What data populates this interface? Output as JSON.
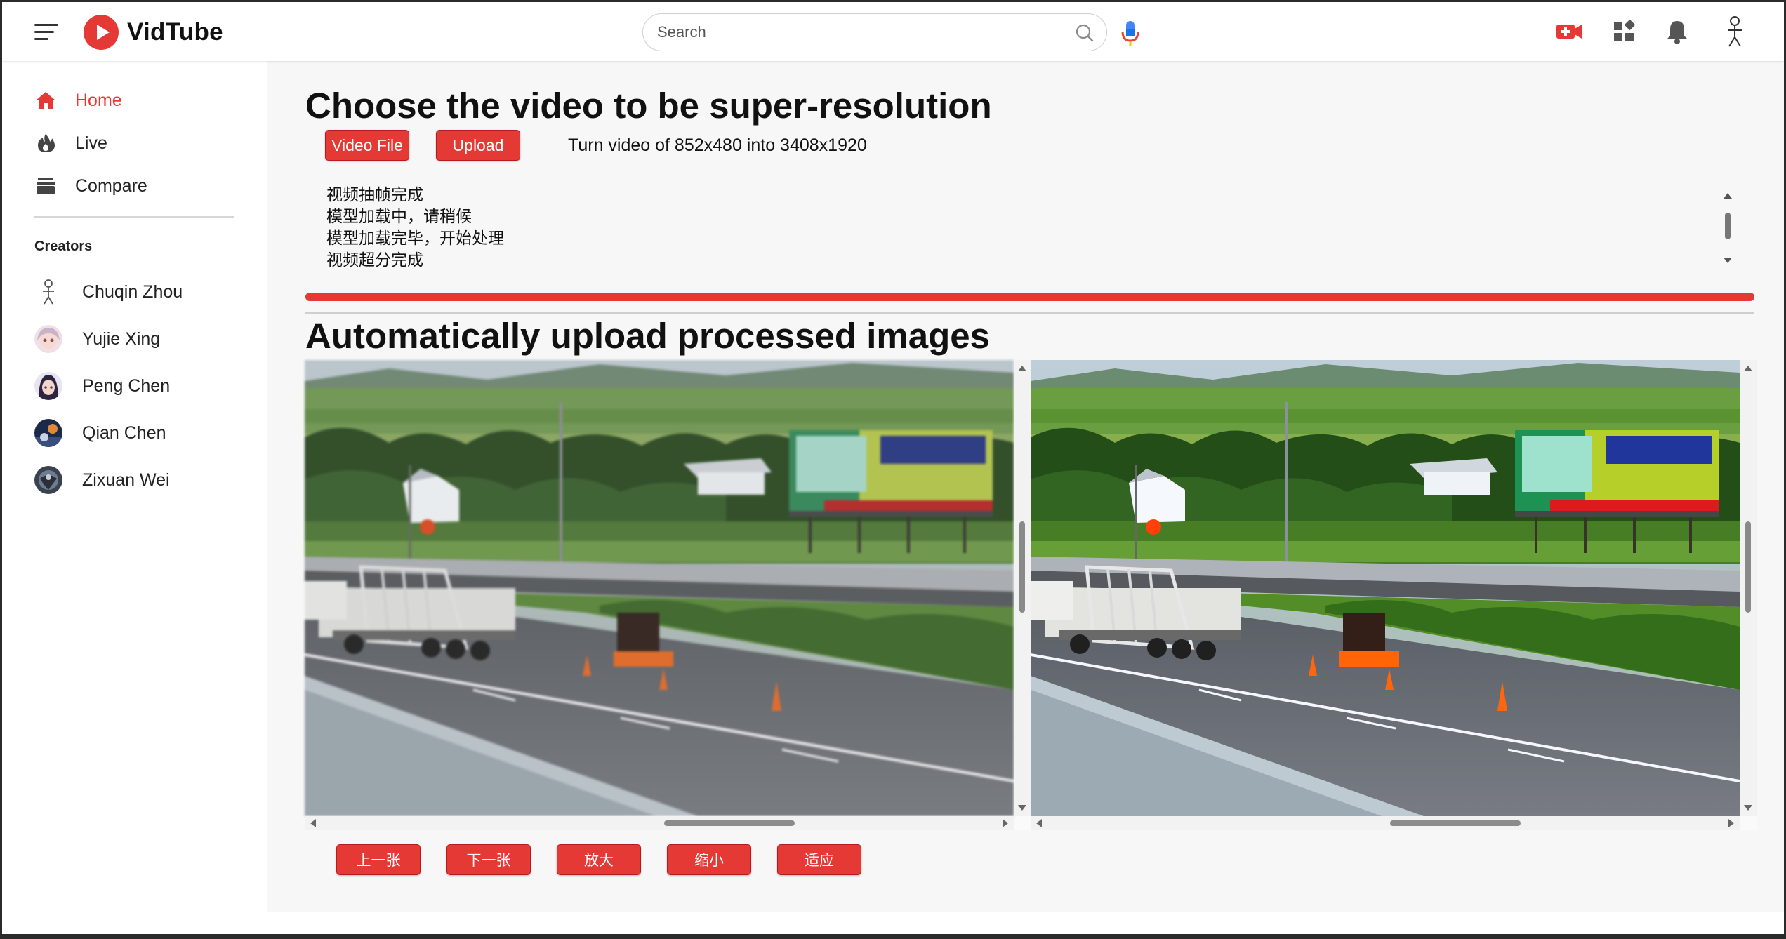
{
  "app": {
    "name": "VidTube"
  },
  "search": {
    "placeholder": "Search"
  },
  "sidebar": {
    "items": [
      {
        "label": "Home",
        "active": true
      },
      {
        "label": "Live",
        "active": false
      },
      {
        "label": "Compare",
        "active": false
      }
    ],
    "creators_title": "Creators",
    "creators": [
      {
        "name": "Chuqin Zhou"
      },
      {
        "name": "Yujie Xing"
      },
      {
        "name": "Peng Chen"
      },
      {
        "name": "Qian Chen"
      },
      {
        "name": "Zixuan Wei"
      }
    ]
  },
  "main": {
    "title": "Choose the video to be super-resolution",
    "video_file_label": "Video File",
    "upload_label": "Upload",
    "info_text": "Turn video of 852x480 into 3408x1920",
    "log_lines": [
      "视频抽帧完成",
      "模型加载中，请稍候",
      "模型加载完毕，开始处理",
      "视频超分完成"
    ],
    "progress_percent": 100,
    "section_title": "Automatically upload processed images",
    "controls": {
      "prev": "上一张",
      "next": "下一张",
      "zoom_in": "放大",
      "zoom_out": "缩小",
      "fit": "适应"
    }
  },
  "colors": {
    "accent": "#e53935",
    "text": "#111111",
    "background": "#f7f7f7"
  },
  "icons": {
    "menu": "menu-icon",
    "logo": "play-logo-icon",
    "search": "search-icon",
    "mic": "mic-icon",
    "create": "video-add-icon",
    "apps": "apps-icon",
    "notifications": "bell-icon",
    "profile": "stick-figure-avatar-icon"
  }
}
